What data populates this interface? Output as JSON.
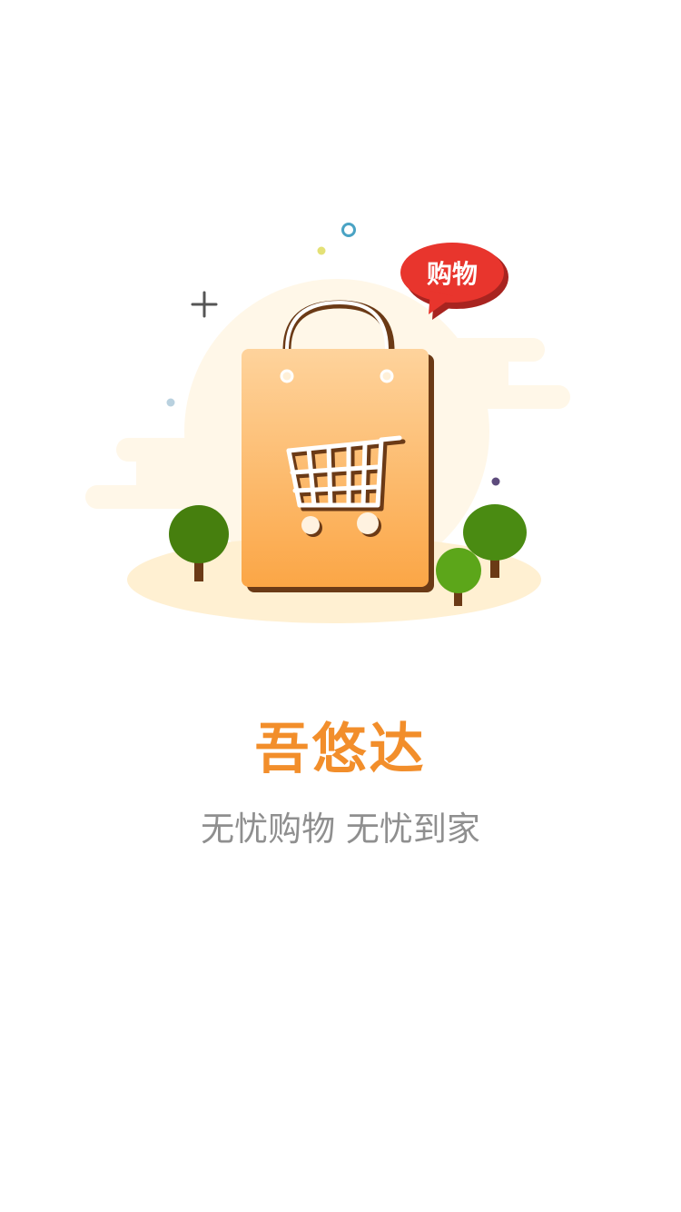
{
  "splash": {
    "app_name": "吾悠达",
    "tagline": "无忧购物 无忧到家",
    "bubble_text": "购物"
  },
  "illustration": {
    "icon": "shopping-bag-with-cart-icon"
  },
  "colors": {
    "brand_orange": "#f28e2b",
    "tagline_gray": "#8f8f8f",
    "bubble_red": "#e8352d",
    "bag_top": "#fdd39c",
    "bag_bottom": "#fba545",
    "tree_green": "#4a8b12"
  }
}
